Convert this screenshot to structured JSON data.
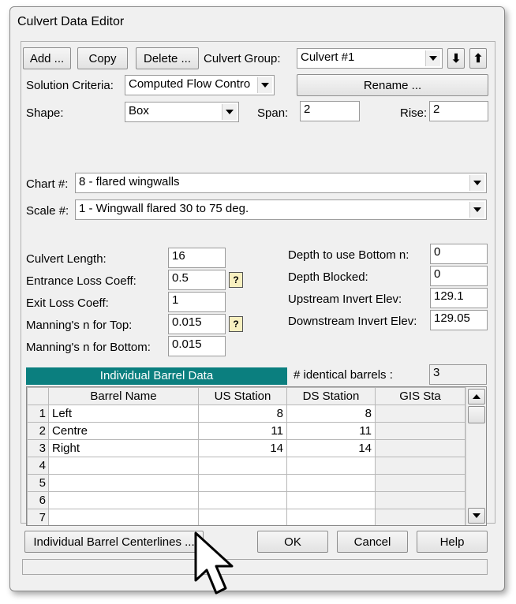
{
  "window": {
    "title": "Culvert Data Editor"
  },
  "toolbar": {
    "add": "Add ...",
    "copy": "Copy",
    "delete": "Delete ...",
    "group_label": "Culvert Group:",
    "group_value": "Culvert #1",
    "rename": "Rename ..."
  },
  "solution": {
    "label": "Solution Criteria:",
    "value": "Computed Flow Contro"
  },
  "shape": {
    "label": "Shape:",
    "value": "Box",
    "span_label": "Span:",
    "span_value": "2",
    "rise_label": "Rise:",
    "rise_value": "2"
  },
  "chart": {
    "label": "Chart #:",
    "value": "8 - flared wingwalls"
  },
  "scale": {
    "label": "Scale #:",
    "value": "1 - Wingwall flared 30 to 75 deg."
  },
  "params_left": [
    {
      "label": "Culvert Length:",
      "value": "16"
    },
    {
      "label": "Entrance Loss Coeff:",
      "value": "0.5"
    },
    {
      "label": "Exit Loss Coeff:",
      "value": "1"
    },
    {
      "label": "Manning's n for Top:",
      "value": "0.015"
    },
    {
      "label": "Manning's n for Bottom:",
      "value": "0.015"
    }
  ],
  "params_right": [
    {
      "label": "Depth to use Bottom n:",
      "value": "0"
    },
    {
      "label": "Depth Blocked:",
      "value": "0"
    },
    {
      "label": "Upstream Invert Elev:",
      "value": "129.1"
    },
    {
      "label": "Downstream Invert Elev:",
      "value": "129.05"
    }
  ],
  "barrels": {
    "header": "Individual Barrel Data",
    "identical_label": "# identical barrels :",
    "identical_value": "3",
    "columns": [
      "Barrel Name",
      "US Station",
      "DS Station",
      "GIS Sta"
    ],
    "rows": [
      {
        "num": "1",
        "name": "Left",
        "us": "8",
        "ds": "8"
      },
      {
        "num": "2",
        "name": "Centre",
        "us": "11",
        "ds": "11"
      },
      {
        "num": "3",
        "name": "Right",
        "us": "14",
        "ds": "14"
      },
      {
        "num": "4",
        "name": "",
        "us": "",
        "ds": ""
      },
      {
        "num": "5",
        "name": "",
        "us": "",
        "ds": ""
      },
      {
        "num": "6",
        "name": "",
        "us": "",
        "ds": ""
      },
      {
        "num": "7",
        "name": "",
        "us": "",
        "ds": ""
      }
    ]
  },
  "footer": {
    "centerlines": "Individual Barrel Centerlines ...",
    "ok": "OK",
    "cancel": "Cancel",
    "help": "Help"
  },
  "colors": {
    "header_bg": "#0b7f7f",
    "window_bg": "#f0f0f0"
  },
  "icons": {
    "up_arrow": "⬆",
    "down_arrow": "⬇",
    "help": "?"
  }
}
